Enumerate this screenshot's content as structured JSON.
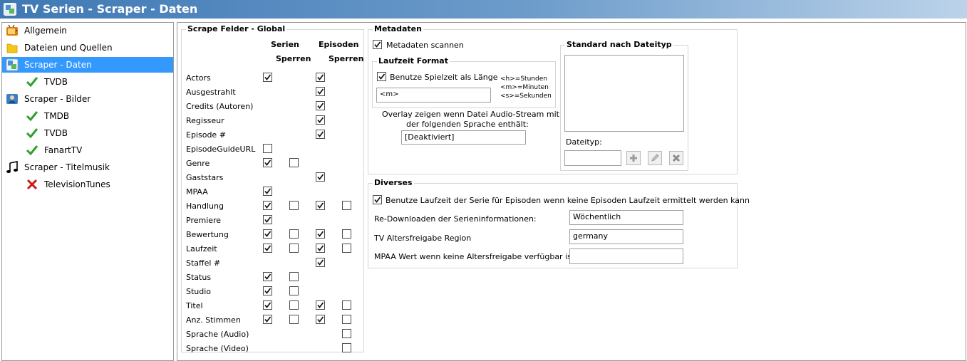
{
  "window": {
    "title": "TV Serien - Scraper - Daten"
  },
  "nav": [
    {
      "label": "Allgemein",
      "icon": "tv-icon",
      "level": 0,
      "selected": false
    },
    {
      "label": "Dateien und Quellen",
      "icon": "folder-icon",
      "level": 0,
      "selected": false
    },
    {
      "label": "Scraper - Daten",
      "icon": "scraper-data-icon",
      "level": 0,
      "selected": true
    },
    {
      "label": "TVDB",
      "icon": "check-icon",
      "level": 1,
      "selected": false
    },
    {
      "label": "Scraper - Bilder",
      "icon": "scraper-images-icon",
      "level": 0,
      "selected": false
    },
    {
      "label": "TMDB",
      "icon": "check-icon",
      "level": 1,
      "selected": false
    },
    {
      "label": "TVDB",
      "icon": "check-icon",
      "level": 1,
      "selected": false
    },
    {
      "label": "FanartTV",
      "icon": "check-icon",
      "level": 1,
      "selected": false
    },
    {
      "label": "Scraper - Titelmusik",
      "icon": "music-note-icon",
      "level": 0,
      "selected": false
    },
    {
      "label": "TelevisionTunes",
      "icon": "cross-icon",
      "level": 1,
      "selected": false
    }
  ],
  "scrape_fields": {
    "title": "Scrape Felder - Global",
    "headers": {
      "serien": "Serien",
      "episoden": "Episoden",
      "sperren1": "Sperren",
      "sperren2": "Sperren"
    },
    "rows": [
      {
        "label": "Actors",
        "cells": [
          true,
          null,
          true,
          null
        ]
      },
      {
        "label": "Ausgestrahlt",
        "cells": [
          null,
          null,
          true,
          null
        ]
      },
      {
        "label": "Credits (Autoren)",
        "cells": [
          null,
          null,
          true,
          null
        ]
      },
      {
        "label": "Regisseur",
        "cells": [
          null,
          null,
          true,
          null
        ]
      },
      {
        "label": "Episode #",
        "cells": [
          null,
          null,
          true,
          null
        ]
      },
      {
        "label": "EpisodeGuideURL",
        "cells": [
          false,
          null,
          null,
          null
        ]
      },
      {
        "label": "Genre",
        "cells": [
          true,
          false,
          null,
          null
        ]
      },
      {
        "label": "Gaststars",
        "cells": [
          null,
          null,
          true,
          null
        ]
      },
      {
        "label": "MPAA",
        "cells": [
          true,
          null,
          null,
          null
        ]
      },
      {
        "label": "Handlung",
        "cells": [
          true,
          false,
          true,
          false
        ]
      },
      {
        "label": "Premiere",
        "cells": [
          true,
          null,
          null,
          null
        ]
      },
      {
        "label": "Bewertung",
        "cells": [
          true,
          false,
          true,
          false
        ]
      },
      {
        "label": "Laufzeit",
        "cells": [
          true,
          false,
          true,
          false
        ]
      },
      {
        "label": "Staffel #",
        "cells": [
          null,
          null,
          true,
          null
        ]
      },
      {
        "label": "Status",
        "cells": [
          true,
          false,
          null,
          null
        ]
      },
      {
        "label": "Studio",
        "cells": [
          true,
          false,
          null,
          null
        ]
      },
      {
        "label": "Titel",
        "cells": [
          true,
          false,
          true,
          false
        ]
      },
      {
        "label": "Anz. Stimmen",
        "cells": [
          true,
          false,
          true,
          false
        ]
      },
      {
        "label": "Sprache (Audio)",
        "cells": [
          null,
          null,
          null,
          false
        ]
      },
      {
        "label": "Sprache (Video)",
        "cells": [
          null,
          null,
          null,
          false
        ]
      }
    ]
  },
  "metadaten": {
    "title": "Metadaten",
    "scan_label": "Metadaten scannen",
    "scan_checked": true,
    "laufzeit": {
      "title": "Laufzeit Format",
      "use_label": "Benutze Spielzeit als Länge",
      "use_checked": true,
      "format_value": "<m>",
      "legend_h": "<h>=Stunden",
      "legend_m": "<m>=Minuten",
      "legend_s": "<s>=Sekunden"
    },
    "overlay_line1": "Overlay zeigen wenn Datei Audio-Stream mit",
    "overlay_line2": "der folgenden Sprache enthält:",
    "overlay_value": "[Deaktiviert]",
    "standard": {
      "title": "Standard nach Dateityp",
      "dateityp_label": "Dateityp:",
      "dateityp_value": ""
    }
  },
  "diverses": {
    "title": "Diverses",
    "use_runtime_label": "Benutze Laufzeit der Serie für Episoden wenn keine Episoden Laufzeit ermittelt werden kann",
    "use_runtime_checked": true,
    "redownload_label": "Re-Downloaden der Serieninformationen:",
    "redownload_value": "Wöchentlich",
    "region_label": "TV Altersfreigabe Region",
    "region_value": "germany",
    "mpaa_label": "MPAA Wert wenn keine Altersfreigabe verfügbar ist",
    "mpaa_value": ""
  },
  "colors": {
    "selection": "#3399ff",
    "titlebar": "#3f78b4",
    "check_green": "#2fa02f",
    "cross_red": "#d01818"
  }
}
